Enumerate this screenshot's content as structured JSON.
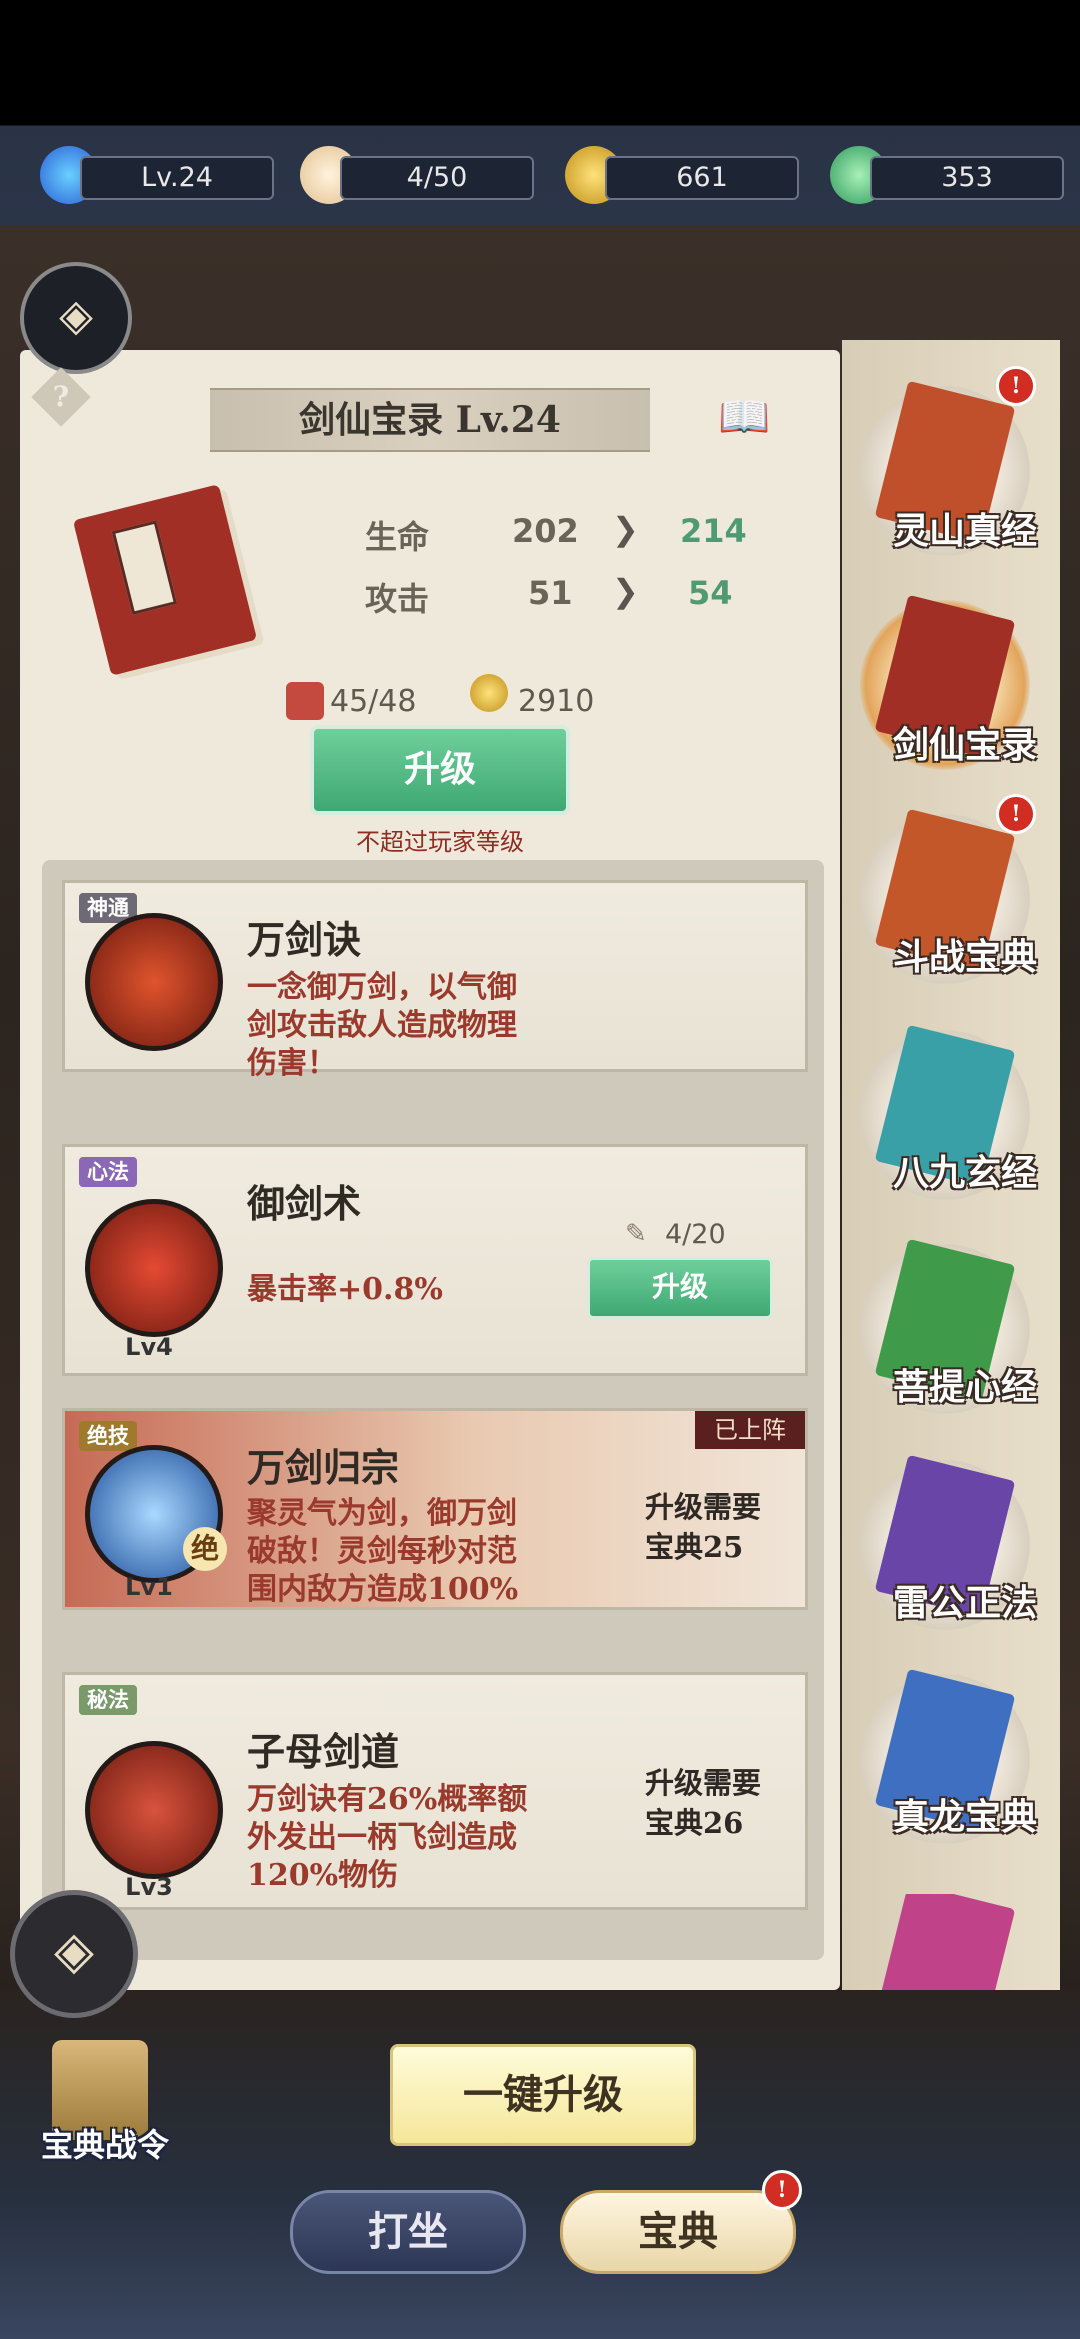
{
  "topbar": {
    "level": "Lv.24",
    "stamina": "4/50",
    "coins": "661",
    "jade": "353"
  },
  "book": {
    "title": "剑仙宝录 Lv.24",
    "stats": [
      {
        "label": "生命",
        "current": "202",
        "next": "214"
      },
      {
        "label": "攻击",
        "current": "51",
        "next": "54"
      }
    ],
    "cost_material": "45/48",
    "cost_coins": "2910",
    "upgrade_label": "升级",
    "limit_note": "不超过玩家等级"
  },
  "skills": [
    {
      "tag": "神通",
      "name": "万剑诀",
      "desc_lines": [
        "一念御万剑，以气御",
        "剑攻击敌人造成物理",
        "伤害！"
      ]
    },
    {
      "tag": "心法",
      "name": "御剑术",
      "desc": "暴击率+0.8%",
      "level": "Lv4",
      "progress": "4/20",
      "upgrade_label": "升级"
    },
    {
      "tag": "绝技",
      "name": "万剑归宗",
      "badge": "已上阵",
      "desc_lines": [
        "聚灵气为剑，御万剑",
        "破敌！灵剑每秒对范",
        "围内敌方造成100%"
      ],
      "level": "Lv1",
      "mark": "绝",
      "req_lines": [
        "升级需要",
        "宝典25"
      ]
    },
    {
      "tag": "秘法",
      "name": "子母剑道",
      "desc_lines": [
        "万剑诀有26%概率额",
        "外发出一柄飞剑造成",
        "120%物伤"
      ],
      "level": "Lv3",
      "req_lines": [
        "升级需要",
        "宝典26"
      ]
    }
  ],
  "sidebar": [
    {
      "name": "灵山真经",
      "alert": true,
      "color": "#c0502b"
    },
    {
      "name": "剑仙宝录",
      "alert": false,
      "color": "#a22f26",
      "selected": true
    },
    {
      "name": "斗战宝典",
      "alert": true,
      "color": "#c4572a"
    },
    {
      "name": "八九玄经",
      "alert": false,
      "color": "#3aa0a8"
    },
    {
      "name": "菩提心经",
      "alert": false,
      "color": "#3f9a4a"
    },
    {
      "name": "雷公正法",
      "alert": false,
      "color": "#6a45a8"
    },
    {
      "name": "真龙宝典",
      "alert": false,
      "color": "#3f6fc0"
    },
    {
      "name": "",
      "alert": false,
      "color": "#c0438a"
    }
  ],
  "bottom": {
    "one_click": "一键升级",
    "pass_label": "宝典战令",
    "nav_meditate": "打坐",
    "nav_book": "宝典",
    "alert": "!"
  },
  "colors": {
    "accent_green": "#4f9a72",
    "desc_red": "#9a3a2d",
    "button_green": "#3ea873"
  }
}
